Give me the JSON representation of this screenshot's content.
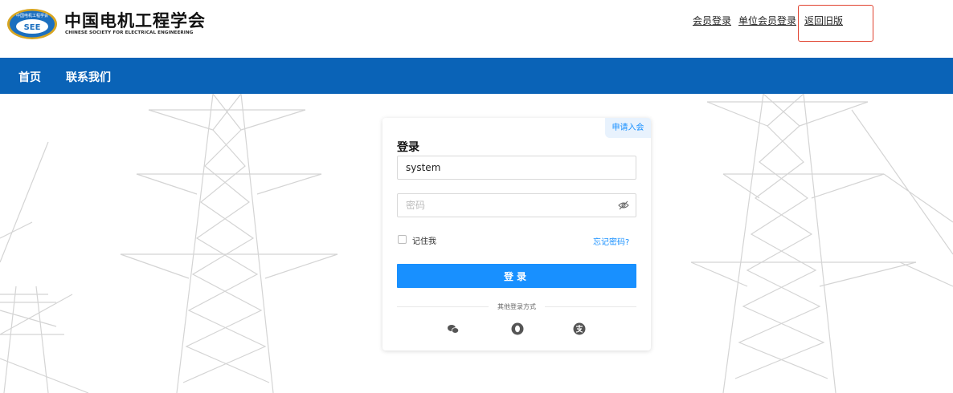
{
  "header": {
    "logo_badge": "SEE",
    "logo_arc_text": "中国电机工程学会",
    "org_name_cn": "中国电机工程学会",
    "org_name_en": "CHINESE SOCIETY FOR ELECTRICAL ENGINEERING",
    "links": {
      "member_login": "会员登录",
      "unit_member_login": "单位会员登录",
      "back_to_old": "返回旧版"
    },
    "highlight_color": "#e0412e"
  },
  "nav": {
    "bg_color": "#0a63b7",
    "items": [
      {
        "label": "首页"
      },
      {
        "label": "联系我们"
      }
    ]
  },
  "login_card": {
    "apply_tag": "申请入会",
    "title": "登录",
    "username_value": "system",
    "password_placeholder": "密码",
    "remember_label": "记住我",
    "forgot_password": "忘记密码?",
    "login_button": "登录",
    "other_methods": "其他登录方式",
    "social_icons": [
      "wechat-icon",
      "qq-icon",
      "alipay-icon"
    ],
    "accent_color": "#1890ff"
  }
}
